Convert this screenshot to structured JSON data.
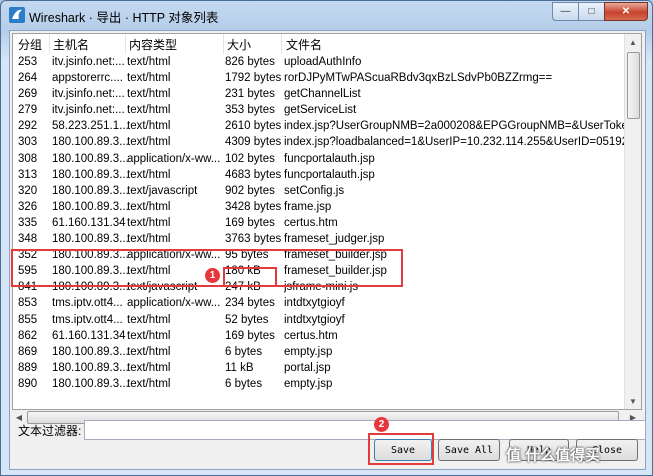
{
  "window": {
    "title": "Wireshark · 导出 · HTTP 对象列表"
  },
  "columns": [
    "分组",
    "主机名",
    "内容类型",
    "大小",
    "文件名"
  ],
  "rows": [
    {
      "num": "253",
      "host": "itv.jsinfo.net:...",
      "type": "text/html",
      "size": "826 bytes",
      "file": "uploadAuthInfo"
    },
    {
      "num": "264",
      "host": "appstorerrc....",
      "type": "text/html",
      "size": "1792 bytes",
      "file": "rorDJPyMTwPAScuaRBdv3qxBzLSdvPb0BZZrmg=="
    },
    {
      "num": "269",
      "host": "itv.jsinfo.net:...",
      "type": "text/html",
      "size": "231 bytes",
      "file": "getChannelList"
    },
    {
      "num": "279",
      "host": "itv.jsinfo.net:...",
      "type": "text/html",
      "size": "353 bytes",
      "file": "getServiceList"
    },
    {
      "num": "292",
      "host": "58.223.251.1...",
      "type": "text/html",
      "size": "2610 bytes",
      "file": "index.jsp?UserGroupNMB=2a000208&EPGGroupNMB=&UserToke"
    },
    {
      "num": "303",
      "host": "180.100.89.3...",
      "type": "text/html",
      "size": "4309 bytes",
      "file": "index.jsp?loadbalanced=1&UserIP=10.232.114.255&UserID=05192"
    },
    {
      "num": "308",
      "host": "180.100.89.3...",
      "type": "application/x-ww...",
      "size": "102 bytes",
      "file": "funcportalauth.jsp"
    },
    {
      "num": "313",
      "host": "180.100.89.3...",
      "type": "text/html",
      "size": "4683 bytes",
      "file": "funcportalauth.jsp"
    },
    {
      "num": "320",
      "host": "180.100.89.3...",
      "type": "text/javascript",
      "size": "902 bytes",
      "file": "setConfig.js"
    },
    {
      "num": "326",
      "host": "180.100.89.3...",
      "type": "text/html",
      "size": "3428 bytes",
      "file": "frame.jsp"
    },
    {
      "num": "335",
      "host": "61.160.131.34",
      "type": "text/html",
      "size": "169 bytes",
      "file": "certus.htm"
    },
    {
      "num": "348",
      "host": "180.100.89.3...",
      "type": "text/html",
      "size": "3763 bytes",
      "file": "frameset_judger.jsp"
    },
    {
      "num": "352",
      "host": "180.100.89.3...",
      "type": "application/x-ww...",
      "size": "95 bytes",
      "file": "frameset_builder.jsp"
    },
    {
      "num": "595",
      "host": "180.100.89.3...",
      "type": "text/html",
      "size": "180 kB",
      "file": "frameset_builder.jsp"
    },
    {
      "num": "841",
      "host": "180.100.89.3...",
      "type": "text/javascript",
      "size": "247 kB",
      "file": "jsframe-mini.js"
    },
    {
      "num": "853",
      "host": "tms.iptv.ott4...",
      "type": "application/x-ww...",
      "size": "234 bytes",
      "file": "intdtxytgioyf"
    },
    {
      "num": "855",
      "host": "tms.iptv.ott4...",
      "type": "text/html",
      "size": "52 bytes",
      "file": "intdtxytgioyf"
    },
    {
      "num": "862",
      "host": "61.160.131.34",
      "type": "text/html",
      "size": "169 bytes",
      "file": "certus.htm"
    },
    {
      "num": "869",
      "host": "180.100.89.3...",
      "type": "text/html",
      "size": "6 bytes",
      "file": "empty.jsp"
    },
    {
      "num": "889",
      "host": "180.100.89.3...",
      "type": "text/html",
      "size": "11 kB",
      "file": "portal.jsp"
    },
    {
      "num": "890",
      "host": "180.100.89.3...",
      "type": "text/html",
      "size": "6 bytes",
      "file": "empty.jsp"
    }
  ],
  "filter": {
    "label": "文本过滤器:",
    "value": ""
  },
  "buttons": {
    "save": "Save",
    "save_all": "Save All",
    "help": "Help",
    "close": "Close"
  },
  "annotations": {
    "badge1": "1",
    "badge2": "2",
    "color": "#e23b3b"
  },
  "watermark": "值 什么值得买"
}
